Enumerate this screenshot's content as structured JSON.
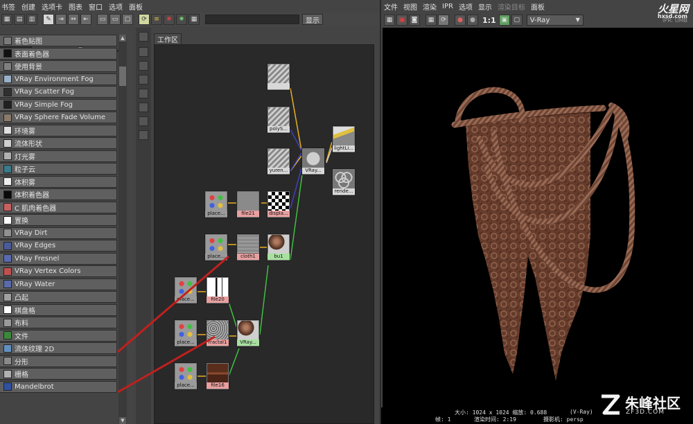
{
  "hypershade": {
    "menu": [
      "书签",
      "创建",
      "选项卡",
      "图表",
      "窗口",
      "选项",
      "面板"
    ],
    "show_button": "显示",
    "filter_value": "",
    "work_tab": "工作区",
    "library": [
      {
        "label": "着色贴图",
        "icon": "#7a7a7a"
      },
      {
        "label": "表面着色器",
        "icon": "#111111"
      },
      {
        "label": "使用背景",
        "icon": "#808080"
      },
      {
        "label": "VRay Environment Fog",
        "icon": "#9ab0c8"
      },
      {
        "label": "VRay Scatter Fog",
        "icon": "#303030"
      },
      {
        "label": "VRay Simple Fog",
        "icon": "#202020"
      },
      {
        "label": "VRay Sphere Fade Volume",
        "icon": "#8a7a6a"
      },
      {
        "label": "环境雾",
        "icon": "#e0e0e0"
      },
      {
        "label": "流体形状",
        "icon": "#cfcfcf"
      },
      {
        "label": "灯光雾",
        "icon": "#b0b0b0"
      },
      {
        "label": "粒子云",
        "icon": "#3a7a8a"
      },
      {
        "label": "体积雾",
        "icon": "#eeeeee"
      },
      {
        "label": "体积着色器",
        "icon": "#0a0a0a"
      },
      {
        "label": "C 肌肉着色器",
        "icon": "#c86060"
      },
      {
        "label": "置换",
        "icon": "#ffffff"
      },
      {
        "label": "VRay Dirt",
        "icon": "#909090"
      },
      {
        "label": "VRay Edges",
        "icon": "#4a5a9a"
      },
      {
        "label": "VRay Fresnel",
        "icon": "#5a6ab0"
      },
      {
        "label": "VRay Vertex Colors",
        "icon": "#c05050"
      },
      {
        "label": "VRay Water",
        "icon": "#5a6aaa"
      },
      {
        "label": "凸起",
        "icon": "#a0a0a0"
      },
      {
        "label": "棋盘格",
        "icon": "#ffffff"
      },
      {
        "label": "布料",
        "icon": "#9a9a9a"
      },
      {
        "label": "文件",
        "icon": "#3a8a3a"
      },
      {
        "label": "流体纹理 2D",
        "icon": "#6090c0"
      },
      {
        "label": "分形",
        "icon": "#8a8a8a"
      },
      {
        "label": "栅格",
        "icon": "#b0b0b0"
      },
      {
        "label": "Mandelbrot",
        "icon": "#3050a0"
      }
    ],
    "nodes": {
      "place_top1": "",
      "place_top2": "polyS...",
      "place_top3": "yuren...",
      "vray_mtl": "VRay...",
      "lightlinker": "lightLi...",
      "render_part": "rende...",
      "place_a": "place...",
      "file21": "file21",
      "displace": "displa...",
      "place_b": "place...",
      "cloth1": "cloth1",
      "bu1": "bu1",
      "place_c": "place...",
      "file20": "file20",
      "place_d": "place...",
      "fractal1": "fractal1",
      "vray_mtl2": "VRay...",
      "place_e": "place...",
      "file16": "file16"
    }
  },
  "renderview": {
    "menu": [
      "文件",
      "视图",
      "渲染",
      "IPR",
      "选项",
      "显示",
      "渲染目标",
      "面板"
    ],
    "ratio": "1:1",
    "renderer": "V-Ray",
    "ipr_tag": "IPR: UMB",
    "info": {
      "size": "大小: 1024 x 1024  缩放: 0.688",
      "frame": "帧: 1",
      "render_time": "渲染时间: 2:19",
      "camera": "摄影机: persp",
      "vray_note": "(V-Ray)"
    }
  },
  "watermarks": {
    "top": "火星网",
    "top_sub": "hxsd.com",
    "bottom": "朱峰社区",
    "bottom_sub": "ZF3D.COM"
  },
  "colors": {
    "accent": "#c0201e",
    "cloth": "#7a4a36"
  }
}
